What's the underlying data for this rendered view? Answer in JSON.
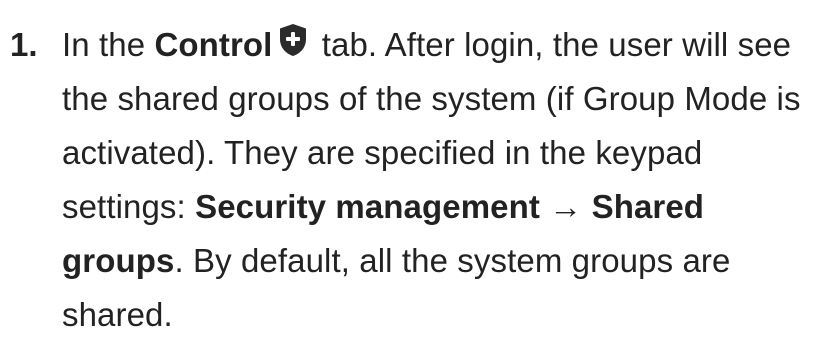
{
  "step": {
    "number": "1.",
    "intro": "In the ",
    "control_label": "Control",
    "control_icon": "shield-plus-icon",
    "after_icon": " tab. After login, the user will see the shared groups of the system (if Group Mode is activated). They are specified in the keypad settings: ",
    "security_mgmt": "Security management",
    "arrow": " → ",
    "shared_groups": "Shared groups",
    "closing": ". By default, all the system groups are shared."
  },
  "colors": {
    "text": "#222222",
    "icon": "#2b2b2b"
  }
}
